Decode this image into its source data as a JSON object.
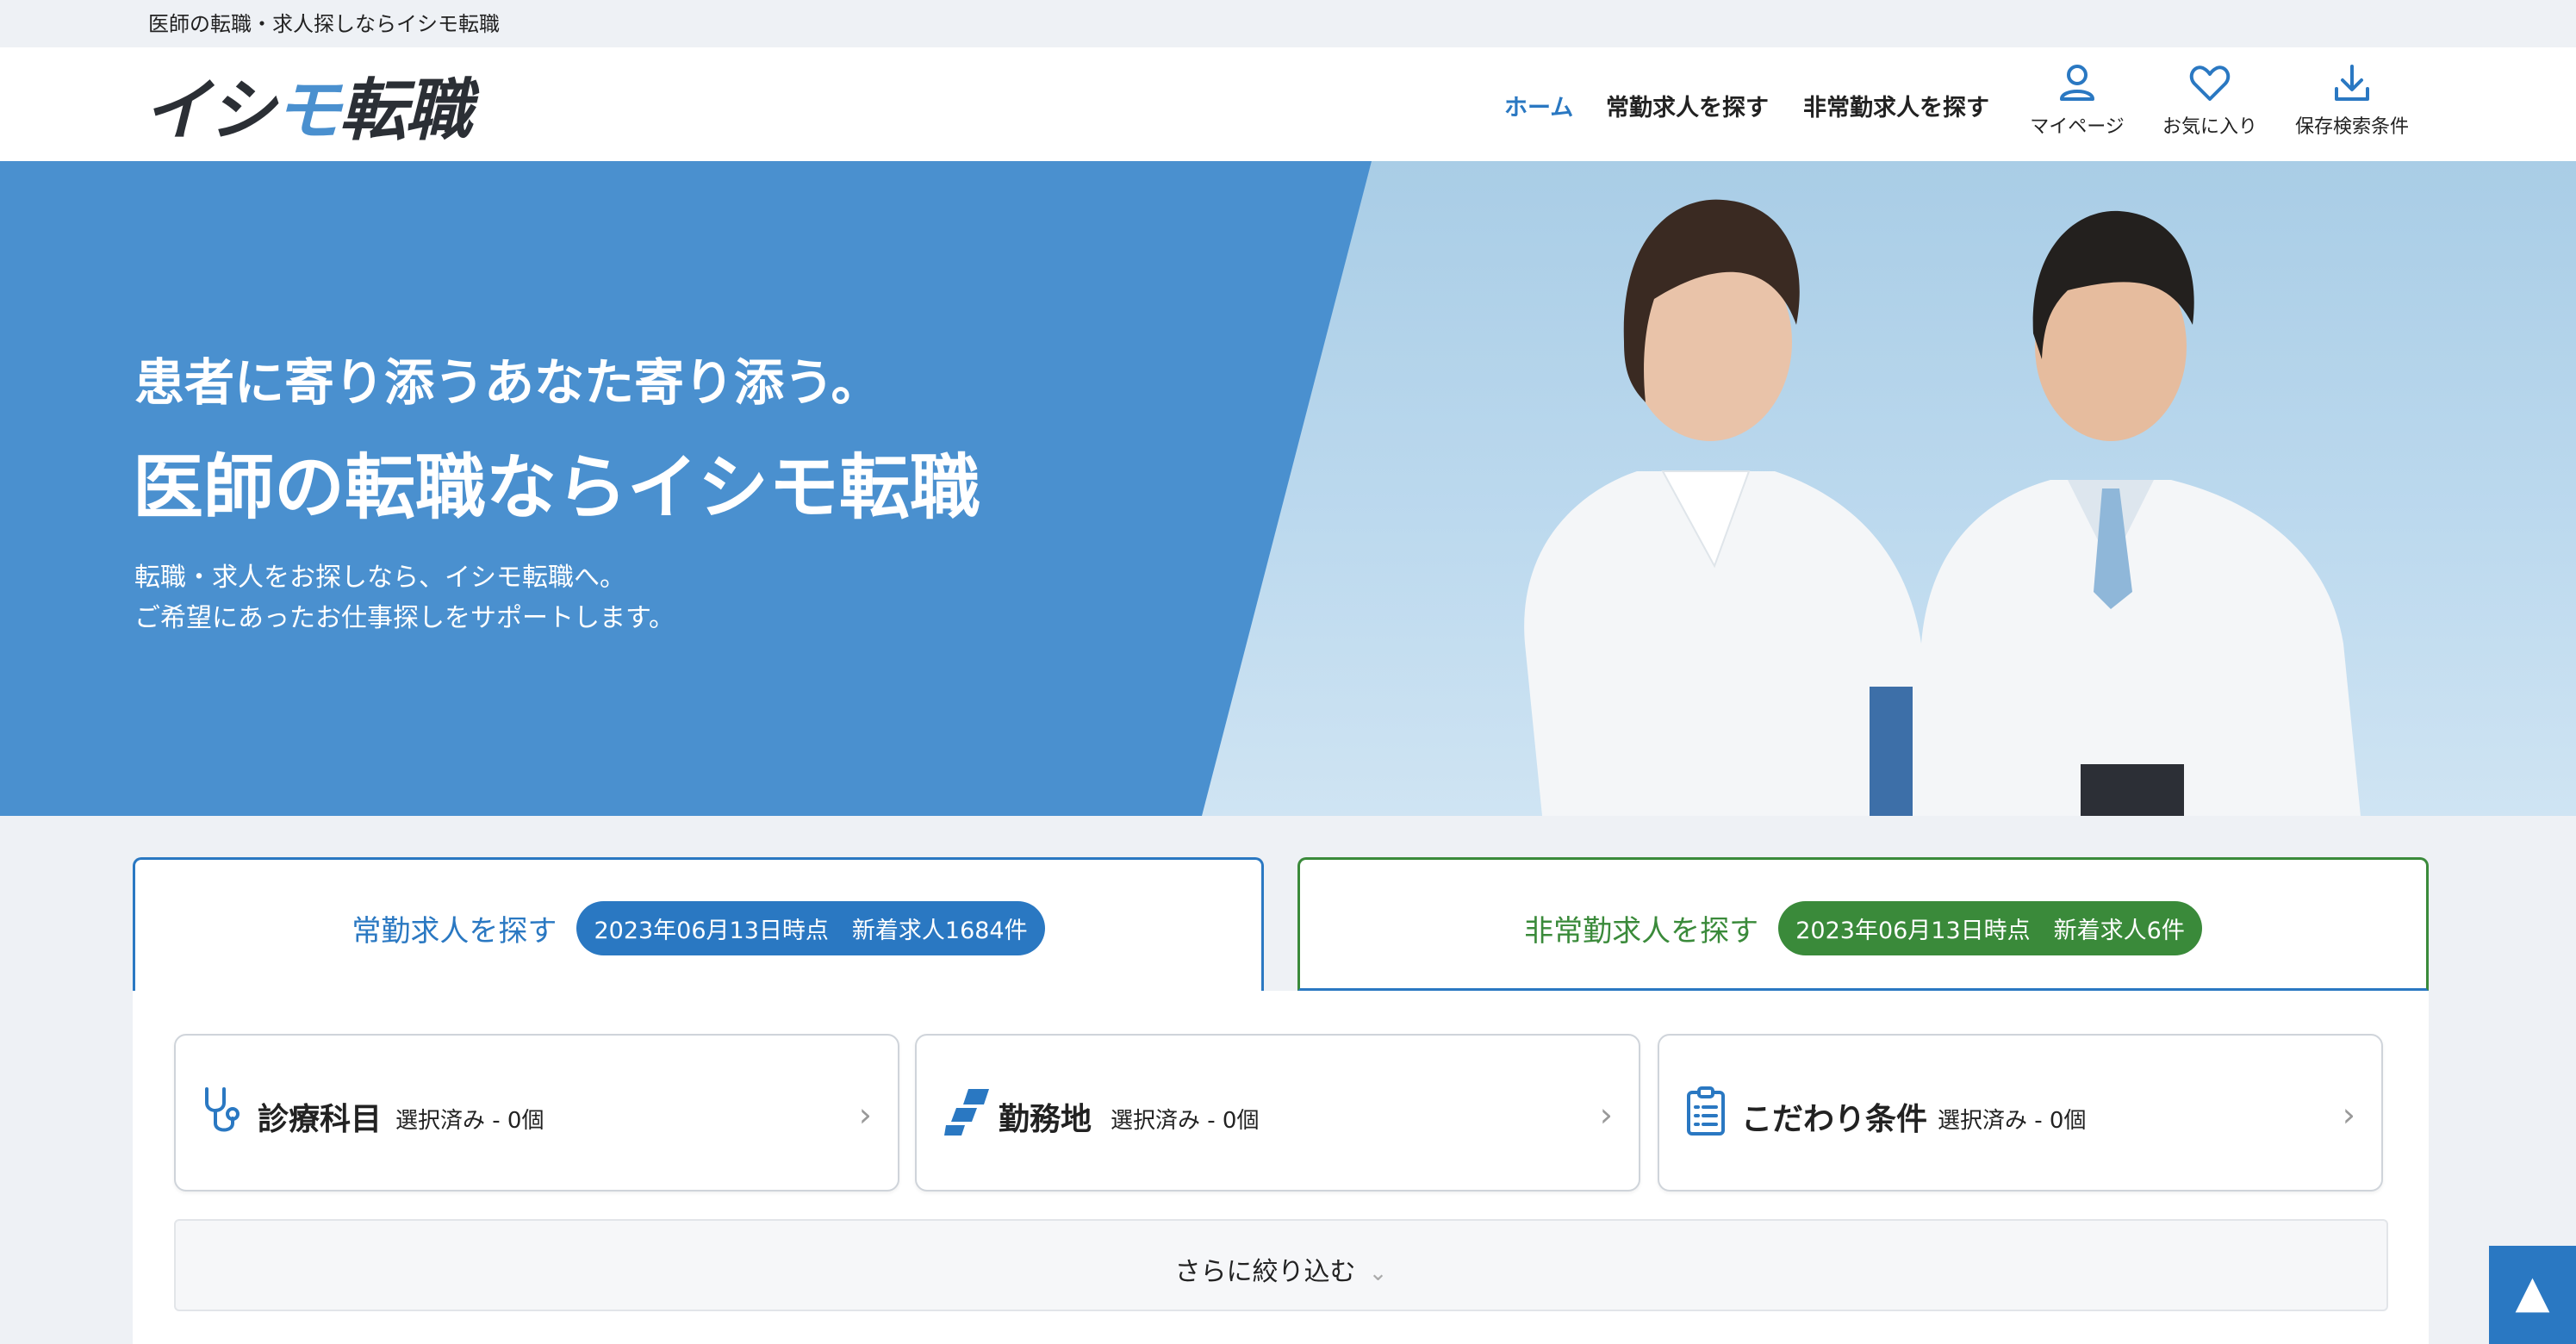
{
  "topbar": {
    "tagline": "医師の転職・求人探しならイシモ転職"
  },
  "header": {
    "logo": {
      "part1": "イシ",
      "part2": "モ",
      "part3": "転職"
    },
    "nav": {
      "home": "ホーム",
      "fulltime": "常勤求人を探す",
      "parttime": "非常勤求人を探す",
      "mypage": "マイページ",
      "favorites": "お気に入り",
      "saved_search": "保存検索条件"
    }
  },
  "hero": {
    "catch": "患者に寄り添うあなた寄り添う。",
    "title": "医師の転職ならイシモ転職",
    "sub1": "転職・求人をお探しなら、イシモ転職へ。",
    "sub2": "ご希望にあったお仕事探しをサポートします。"
  },
  "tabs": {
    "fulltime": {
      "label": "常勤求人を探す",
      "badge": "2023年06月13日時点　新着求人1684件"
    },
    "parttime": {
      "label": "非常勤求人を探す",
      "badge": "2023年06月13日時点　新着求人6件"
    }
  },
  "search": {
    "cards": [
      {
        "name": "診療科目",
        "status": "選択済み - 0個",
        "icon": "stethoscope-icon"
      },
      {
        "name": "勤務地",
        "status": "選択済み - 0個",
        "icon": "location-icon"
      },
      {
        "name": "こだわり条件",
        "status": "選択済み - 0個",
        "icon": "checklist-icon"
      }
    ],
    "more_label": "さらに絞り込む",
    "chevron": "⌄",
    "card_chevron": "›"
  },
  "scroll_top": "▲",
  "colors": {
    "primary": "#2a78c2",
    "hero_blue": "#4a90cf",
    "green": "#3a8a3a"
  }
}
